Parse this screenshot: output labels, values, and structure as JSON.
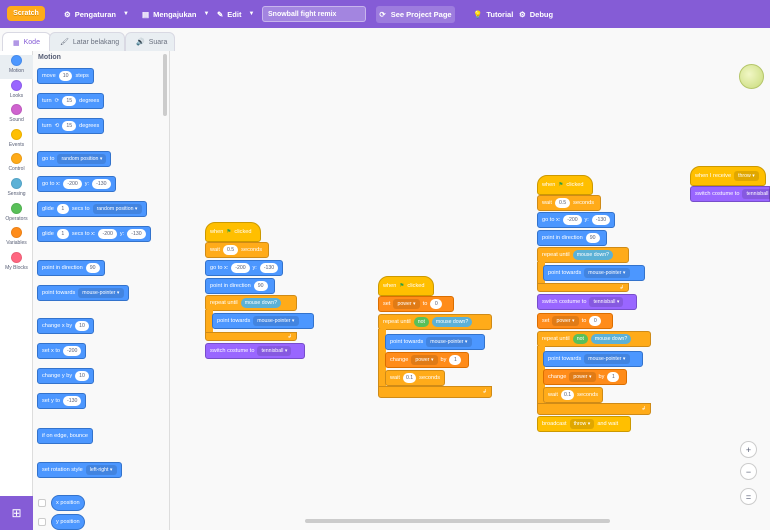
{
  "topbar": {
    "logo": "Scratch",
    "settings": "Pengaturan",
    "submit": "Mengajukan",
    "edit": "Edit",
    "project_title": "Snowball fight remix",
    "see_project": "See Project Page",
    "tutorial": "Tutorial",
    "debug": "Debug"
  },
  "tabs": {
    "code": "Kode",
    "backdrop": "Latar belakang",
    "sound": "Suara"
  },
  "categories": [
    "Motion",
    "Looks",
    "Sound",
    "Events",
    "Control",
    "Sensing",
    "Operators",
    "Variables",
    "My Blocks"
  ],
  "category_colors": [
    "#4c97ff",
    "#9966ff",
    "#cf63cf",
    "#ffbf00",
    "#ffab19",
    "#5cb1d6",
    "#59c059",
    "#ff8c1a",
    "#ff6680"
  ],
  "palette": {
    "heading": "Motion",
    "move": [
      "move",
      "10",
      "steps"
    ],
    "turn_right": [
      "turn",
      "15",
      "degrees"
    ],
    "turn_left": [
      "turn",
      "15",
      "degrees"
    ],
    "goto": [
      "go to",
      "random position"
    ],
    "goto_xy": [
      "go to x:",
      "-200",
      "y:",
      "-130"
    ],
    "glide": [
      "glide",
      "1",
      "secs to",
      "random position"
    ],
    "glide_xy": [
      "glide",
      "1",
      "secs to x:",
      "-200",
      "y:",
      "-130"
    ],
    "point_dir": [
      "point in direction",
      "90"
    ],
    "point_towards": [
      "point towards",
      "mouse-pointer"
    ],
    "change_x": [
      "change x by",
      "10"
    ],
    "set_x": [
      "set x to",
      "-200"
    ],
    "change_y": [
      "change y by",
      "10"
    ],
    "set_y": [
      "set y to",
      "-130"
    ],
    "bounce": "if on edge, bounce",
    "rotation": [
      "set rotation style",
      "left-right"
    ],
    "x_pos": "x position",
    "y_pos": "y position"
  },
  "script1": {
    "hat": [
      "when",
      "clicked"
    ],
    "wait": [
      "wait",
      "0.5",
      "seconds"
    ],
    "goto": [
      "go to x:",
      "-200",
      "y:",
      "-130"
    ],
    "point": [
      "point in direction",
      "90"
    ],
    "repeat": [
      "repeat until",
      "mouse down?"
    ],
    "towards": [
      "point towards",
      "mouse-pointer"
    ],
    "costume": [
      "switch costume to",
      "tennisball"
    ]
  },
  "script2": {
    "hat": [
      "when",
      "clicked"
    ],
    "set": [
      "set",
      "power",
      "to",
      "0"
    ],
    "repeat": [
      "repeat until",
      "not",
      "mouse down?"
    ],
    "towards": [
      "point towards",
      "mouse-pointer"
    ],
    "change": [
      "change",
      "power",
      "by",
      "1"
    ],
    "wait": [
      "wait",
      "0.1",
      "seconds"
    ]
  },
  "script3": {
    "hat": [
      "when",
      "clicked"
    ],
    "wait": [
      "wait",
      "0.5",
      "seconds"
    ],
    "goto": [
      "go to x:",
      "-200",
      "y:",
      "-130"
    ],
    "point": [
      "point in direction",
      "90"
    ],
    "repeat": [
      "repeat until",
      "mouse down?"
    ],
    "towards": [
      "point towards",
      "mouse-pointer"
    ],
    "costume": [
      "switch costume to",
      "tennisball"
    ],
    "set": [
      "set",
      "power",
      "to",
      "0"
    ],
    "repeat2": [
      "repeat until",
      "not",
      "mouse down?"
    ],
    "towards2": [
      "point towards",
      "mouse-pointer"
    ],
    "change": [
      "change",
      "power",
      "by",
      "1"
    ],
    "wait2": [
      "wait",
      "0.1",
      "seconds"
    ],
    "broadcast": [
      "broadcast",
      "throw",
      "and wait"
    ]
  },
  "script4": {
    "hat": [
      "when I receive",
      "throw"
    ],
    "costume": [
      "switch costume to",
      "tennisball"
    ]
  },
  "zoom": {
    "in": "+",
    "out": "−",
    "reset": "="
  }
}
